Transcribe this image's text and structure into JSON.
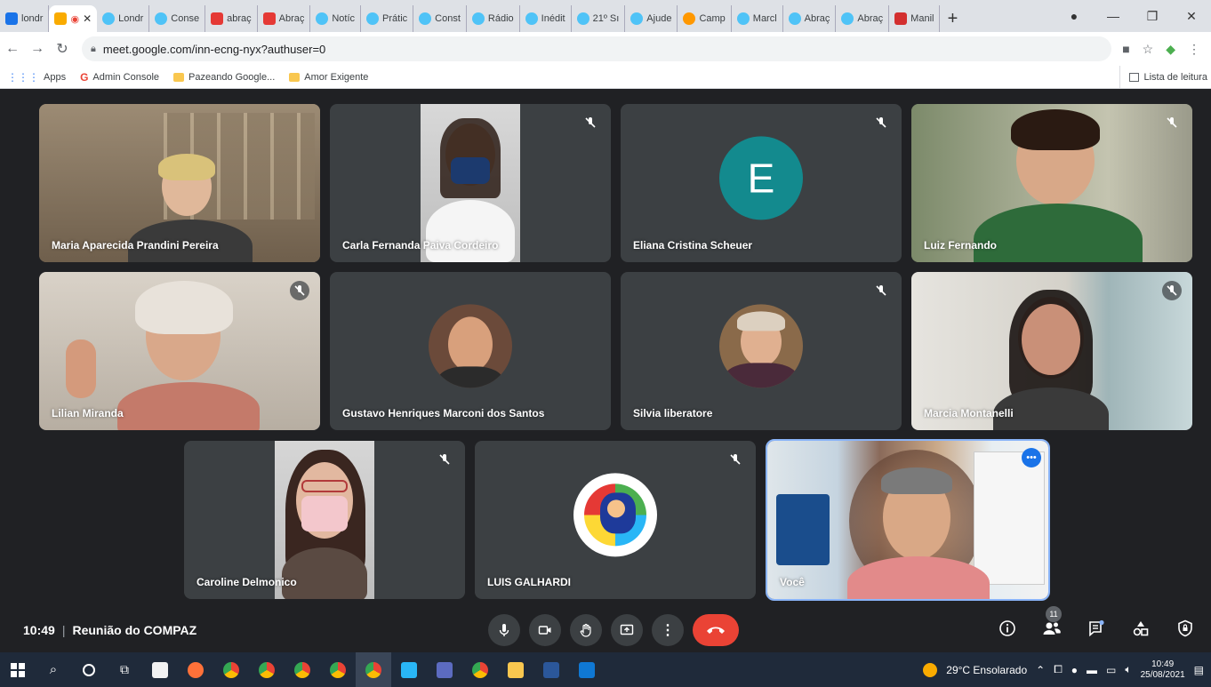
{
  "browser": {
    "tabs": [
      {
        "label": "londr",
        "color": "#1a73e8"
      },
      {
        "label": "",
        "color": "#f9ab00",
        "active": true
      },
      {
        "label": "Londr",
        "color": "#4fc3f7"
      },
      {
        "label": "Conse",
        "color": "#4fc3f7"
      },
      {
        "label": "abraç",
        "color": "#e53935"
      },
      {
        "label": "Abraç",
        "color": "#e53935"
      },
      {
        "label": "Notíc",
        "color": "#4fc3f7"
      },
      {
        "label": "Prátic",
        "color": "#4fc3f7"
      },
      {
        "label": "Const",
        "color": "#4fc3f7"
      },
      {
        "label": "Rádio",
        "color": "#4fc3f7"
      },
      {
        "label": "Inédit",
        "color": "#4fc3f7"
      },
      {
        "label": "21º Sı",
        "color": "#4fc3f7"
      },
      {
        "label": "Ajude",
        "color": "#4fc3f7"
      },
      {
        "label": "Camp",
        "color": "#ff9800"
      },
      {
        "label": "Marcl",
        "color": "#4fc3f7"
      },
      {
        "label": "Abraç",
        "color": "#4fc3f7"
      },
      {
        "label": "Abraç",
        "color": "#4fc3f7"
      },
      {
        "label": "Manil",
        "color": "#d32f2f"
      }
    ],
    "url": "meet.google.com/inn-ecng-nyx?authuser=0",
    "bookmarks": [
      "Apps",
      "Admin Console",
      "Pazeando Google...",
      "Amor Exigente"
    ],
    "reading_list": "Lista de leitura"
  },
  "meet": {
    "time": "10:49",
    "meeting_title": "Reunião do COMPAZ",
    "participant_count": "11",
    "participants": [
      {
        "name": "Maria Aparecida Prandini Pereira",
        "muted": false
      },
      {
        "name": "Carla Fernanda Paiva Cordeiro",
        "muted": true
      },
      {
        "name": "Eliana Cristina Scheuer",
        "muted": true,
        "initial": "E"
      },
      {
        "name": "Luiz Fernando",
        "muted": true
      },
      {
        "name": "Lilian Miranda",
        "muted": true
      },
      {
        "name": "Gustavo Henriques Marconi dos Santos",
        "muted": false
      },
      {
        "name": "Silvia liberatore",
        "muted": true
      },
      {
        "name": "Marcia Montanelli",
        "muted": true
      },
      {
        "name": "Caroline Delmonico",
        "muted": true
      },
      {
        "name": "LUIS GALHARDI",
        "muted": true
      },
      {
        "name": "Você",
        "muted": false
      }
    ]
  },
  "taskbar": {
    "weather": "29°C Ensolarado",
    "time": "10:49",
    "date": "25/08/2021"
  }
}
